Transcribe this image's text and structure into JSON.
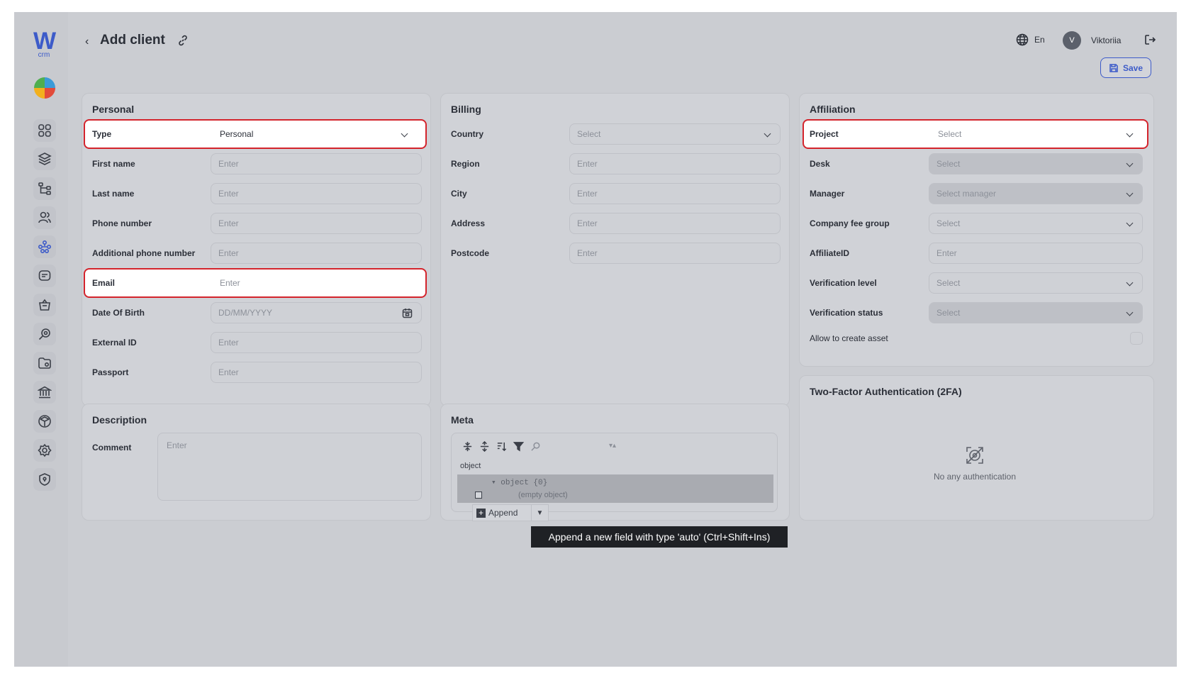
{
  "app": {
    "logo_text": "W",
    "logo_sub": "crm",
    "page_title": "Add client",
    "back_glyph": "‹",
    "language": "En",
    "user_initial": "V",
    "user_name": "Viktoriia",
    "save_label": "Save"
  },
  "sidebar": {
    "icons": [
      "dashboard-icon",
      "layers-icon",
      "tree-icon",
      "users-icon",
      "network-icon",
      "chat-icon",
      "basket-icon",
      "search-key-icon",
      "folder-icon",
      "bank-icon",
      "cube-icon",
      "settings-icon",
      "shield-icon"
    ],
    "active": "network-icon"
  },
  "personal": {
    "title": "Personal",
    "type_label": "Type",
    "type_value": "Personal",
    "first_name_label": "First name",
    "first_name_placeholder": "Enter",
    "last_name_label": "Last name",
    "last_name_placeholder": "Enter",
    "phone_label": "Phone number",
    "phone_placeholder": "Enter",
    "add_phone_label": "Additional phone number",
    "add_phone_placeholder": "Enter",
    "email_label": "Email",
    "email_placeholder": "Enter",
    "dob_label": "Date Of Birth",
    "dob_placeholder": "DD/MM/YYYY",
    "external_id_label": "External ID",
    "external_id_placeholder": "Enter",
    "passport_label": "Passport",
    "passport_placeholder": "Enter"
  },
  "billing": {
    "title": "Billing",
    "country_label": "Country",
    "country_placeholder": "Select",
    "region_label": "Region",
    "region_placeholder": "Enter",
    "city_label": "City",
    "city_placeholder": "Enter",
    "address_label": "Address",
    "address_placeholder": "Enter",
    "postcode_label": "Postcode",
    "postcode_placeholder": "Enter"
  },
  "affiliation": {
    "title": "Affiliation",
    "project_label": "Project",
    "project_placeholder": "Select",
    "desk_label": "Desk",
    "desk_placeholder": "Select",
    "manager_label": "Manager",
    "manager_placeholder": "Select manager",
    "fee_group_label": "Company fee group",
    "fee_group_placeholder": "Select",
    "affiliate_id_label": "AffiliateID",
    "affiliate_id_placeholder": "Enter",
    "verification_level_label": "Verification level",
    "verification_level_placeholder": "Select",
    "verification_status_label": "Verification status",
    "verification_status_placeholder": "Select",
    "allow_asset_label": "Allow to create asset"
  },
  "description": {
    "title": "Description",
    "comment_label": "Comment",
    "comment_placeholder": "Enter"
  },
  "meta": {
    "title": "Meta",
    "object_label": "object",
    "tree_node": "▾ object {0}",
    "empty_text": "(empty object)",
    "append_label": "Append",
    "append_arrow": "▼",
    "sort_arrows": "▾▴",
    "tooltip": "Append a new field with type 'auto' (Ctrl+Shift+Ins)"
  },
  "twofa": {
    "title": "Two-Factor Authentication (2FA)",
    "empty_text": "No any authentication"
  },
  "colors": {
    "accent": "#3d5bc9",
    "highlight": "#d4242c"
  }
}
